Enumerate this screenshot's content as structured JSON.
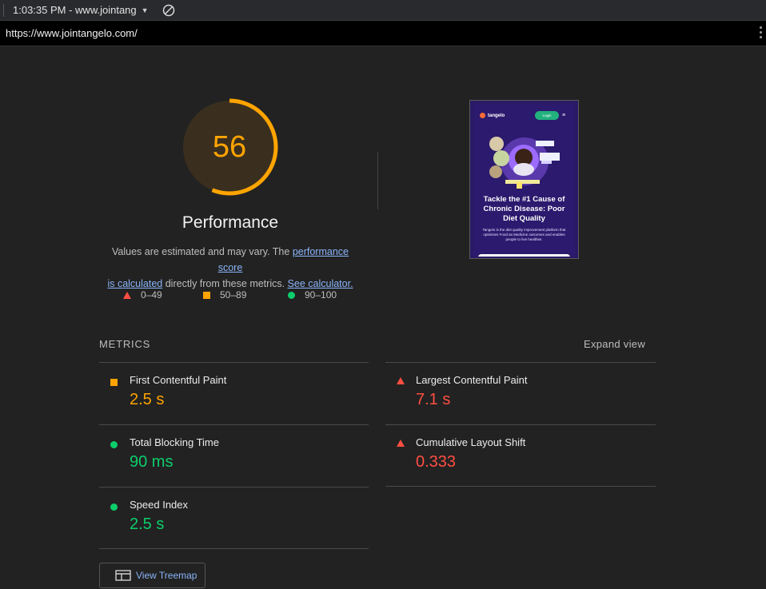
{
  "topbar": {
    "time_url": "1:03:35 PM - www.jointang",
    "caret": "▼"
  },
  "urlbar": {
    "url": "https://www.jointangelo.com/"
  },
  "gauge": {
    "score": "56",
    "score_fraction": 0.56,
    "color": "#ffa400"
  },
  "performance": {
    "title": "Performance",
    "desc_prefix": "Values are estimated and may vary. The ",
    "link_score": "performance score",
    "link_calc": "is calculated",
    "desc_middle": " directly from these metrics. ",
    "link_see": "See calculator."
  },
  "legend": {
    "fail": "0–49",
    "average": "50–89",
    "pass": "90–100"
  },
  "thumbnail": {
    "brand": "tangelo",
    "login": "Login",
    "menu": "≡",
    "heading": "Tackle the #1 Cause of Chronic Disease: Poor Diet Quality",
    "body": "Tangelo is the diet quality improvement platform that optimises Food as Medicine outcomes and enables people to live healthier."
  },
  "metrics": {
    "header": "METRICS",
    "expand": "Expand view",
    "items": [
      {
        "label": "First Contentful Paint",
        "value": "2.5 s",
        "rating": "average"
      },
      {
        "label": "Largest Contentful Paint",
        "value": "7.1 s",
        "rating": "fail"
      },
      {
        "label": "Total Blocking Time",
        "value": "90 ms",
        "rating": "pass"
      },
      {
        "label": "Cumulative Layout Shift",
        "value": "0.333",
        "rating": "fail"
      },
      {
        "label": "Speed Index",
        "value": "2.5 s",
        "rating": "pass"
      }
    ]
  },
  "treemap": {
    "label": "View Treemap"
  },
  "colors": {
    "fail": "#ff4e42",
    "average": "#ffa400",
    "pass": "#0cce6b",
    "link": "#8ab4f8"
  }
}
